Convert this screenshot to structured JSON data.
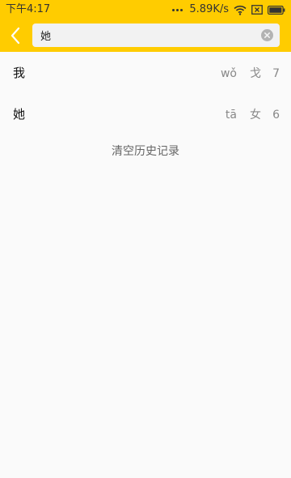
{
  "status_bar": {
    "time": "下午4:17",
    "net_speed": "5.89K/s"
  },
  "search": {
    "query": "她",
    "placeholder": ""
  },
  "history": [
    {
      "char": "我",
      "pinyin": "wǒ",
      "radical": "戈",
      "strokes": "7"
    },
    {
      "char": "她",
      "pinyin": "tā",
      "radical": "女",
      "strokes": "6"
    }
  ],
  "clear_history_label": "清空历史记录",
  "colors": {
    "accent": "#ffcc00",
    "background": "#fafafa",
    "secondary_text": "#888888"
  },
  "icons": [
    "back-arrow-icon",
    "clear-icon",
    "wifi-icon",
    "close-box-icon",
    "battery-icon"
  ]
}
